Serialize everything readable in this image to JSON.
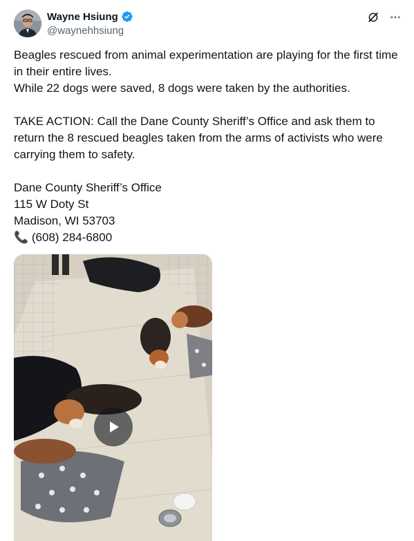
{
  "author": {
    "name": "Wayne Hsiung",
    "handle": "@waynehhsiung",
    "verified": true
  },
  "icons": {
    "verified": "verified-badge-icon",
    "grok": "grok-icon",
    "more": "more-icon"
  },
  "tweet": {
    "text": "Beagles rescued from animal experimentation are playing for the first time in their entire lives.\nWhile 22 dogs were saved, 8 dogs were taken by the authorities.\n\nTAKE ACTION: Call the Dane County Sheriff’s Office and ask them to return the 8 rescued beagles taken from the arms of activists who were carrying them to safety.\n\nDane County Sheriff’s Office\n115 W Doty St\nMadison, WI 53703\n📞 (608) 284-6800"
  },
  "media": {
    "type": "video",
    "description_icon": "play-icon"
  },
  "colors": {
    "verified_blue": "#1d9bf0",
    "text": "#0f1419",
    "muted": "#536471"
  }
}
